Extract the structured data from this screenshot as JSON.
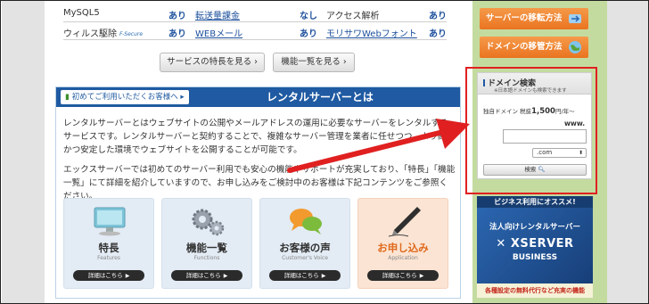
{
  "features": [
    {
      "a_label": "MySQL5",
      "a_val": "あり",
      "b_label": "転送量課金",
      "b_val": "なし",
      "c_label": "アクセス解析",
      "c_val": "あり"
    },
    {
      "a_label": "ウィルス駆除",
      "a_logo": "F-Secure",
      "a_val": "あり",
      "b_label": "WEBメール",
      "b_val": "あり",
      "c_label": "モリサワWebフォント",
      "c_val": "あり"
    }
  ],
  "buttons": {
    "features": "サービスの特長を見る ›",
    "list": "機能一覧を見る ›"
  },
  "intro": {
    "badge": "初めてご利用いただくお客様へ",
    "title": "レンタルサーバーとは",
    "para1": "レンタルサーバーとはウェブサイトの公開やメールアドレスの運用に必要なサーバーをレンタルするサービスです。レンタルサーバーと契約することで、複雑なサーバー管理を業者に任せつつ、より高速かつ安定した環境でウェブサイトを公開することが可能です。",
    "para2": "エックスサーバーでは初めてのサーバー利用でも安心の機能やサポートが充実しており、「特長」「機能一覧」にて詳細を紹介していますので、お申し込みをご検討中のお客様は下記コンテンツをご参照ください。"
  },
  "cards": [
    {
      "title": "特長",
      "sub": "Features",
      "btn": "詳細はこちら"
    },
    {
      "title": "機能一覧",
      "sub": "Functions",
      "btn": "詳細はこちら"
    },
    {
      "title": "お客様の声",
      "sub": "Customer's Voice",
      "btn": "詳細はこちら"
    },
    {
      "title": "お申し込み",
      "sub": "Application",
      "btn": "詳細はこちら"
    }
  ],
  "sidebar": {
    "migrate": "サーバーの移転方法",
    "transfer": "ドメインの移管方法",
    "domain": {
      "title": "ドメイン検索",
      "sub": "※日本語ドメインも検索できます",
      "price_prefix": "独自ドメイン 税抜",
      "price": "1,500",
      "price_suffix": "円/年〜",
      "www": "www.",
      "tld": ".com",
      "search": "検索"
    },
    "promo": {
      "top": "ビジネス利用にオススメ!",
      "line1": "法人向けレンタルサーバー",
      "line2": "XSERVER",
      "line3": "BUSINESS",
      "bottom": "各種設定の無料代行など充実の機能"
    }
  },
  "colors": {
    "accent_blue": "#1f5aa2",
    "sidebar_green": "#c4dba0",
    "orange": "#ea7420",
    "highlight_red": "#e02020"
  }
}
